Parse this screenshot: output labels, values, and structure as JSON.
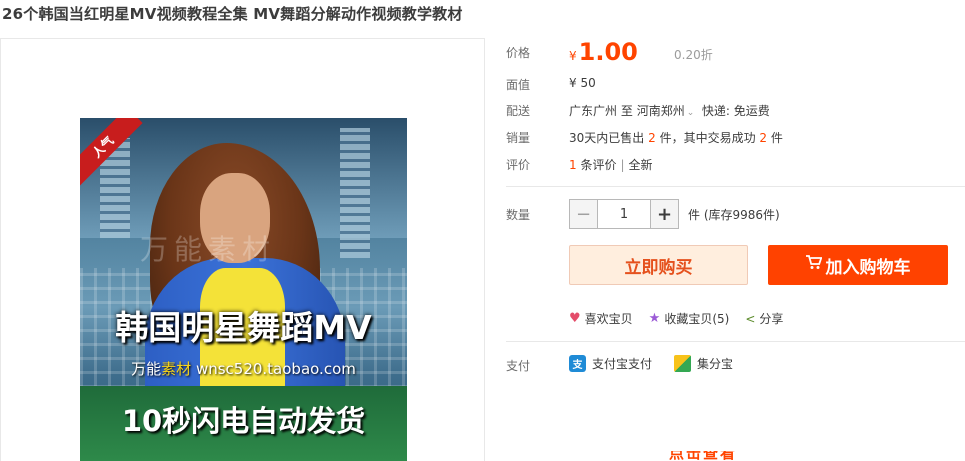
{
  "title": "26个韩国当红明星MV视频教程全集 MV舞蹈分解动作视频教学教材",
  "product_image": {
    "ribbon": "人气",
    "headline": "韩国明星舞蹈MV",
    "sub_prefix": "万能",
    "sub_highlight": "素材",
    "sub_url": "wnsc520.taobao.com",
    "bottom": "10秒闪电自动发货",
    "watermark": "万能素材"
  },
  "price": {
    "label": "价格",
    "currency": "¥",
    "value": "1.00",
    "discount": "0.20折"
  },
  "face_value": {
    "label": "面值",
    "text": "¥ 50"
  },
  "shipping": {
    "label": "配送",
    "from": "广东广州",
    "to_word": "至",
    "to": "河南郑州",
    "express": "快递: 免运费"
  },
  "sales": {
    "label": "销量",
    "prefix": "30天内已售出",
    "sold": "2",
    "middle": "件，其中交易成功",
    "success": "2",
    "suffix": "件"
  },
  "reviews": {
    "label": "评价",
    "count": "1",
    "count_suffix": "条评价",
    "divider": "|",
    "condition": "全新"
  },
  "quantity": {
    "label": "数量",
    "minus": "−",
    "value": "1",
    "plus": "+",
    "stock": "件 (库存9986件)"
  },
  "buttons": {
    "buy_now": "立即购买",
    "add_to_cart": "加入购物车"
  },
  "actions": {
    "like": "喜欢宝贝",
    "favorite": "收藏宝贝(5)",
    "share": "分享"
  },
  "payment": {
    "label": "支付",
    "alipay": "支付宝支付",
    "jifenbao": "集分宝"
  },
  "cutoff_text": "点击查看"
}
